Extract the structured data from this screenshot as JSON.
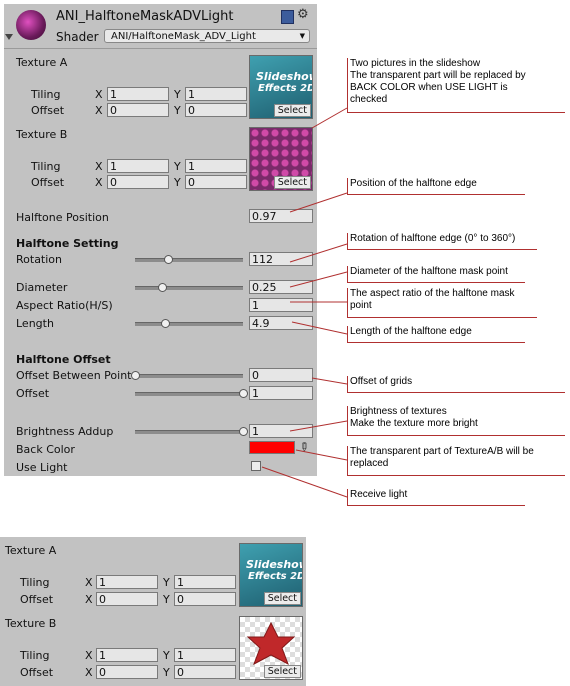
{
  "header": {
    "title": "ANI_HalftoneMaskADVLight",
    "shader_label": "Shader",
    "shader_value": "ANI/HalftoneMask_ADV_Light"
  },
  "textures": [
    {
      "label": "Texture A",
      "tiling_label": "Tiling",
      "offset_label": "Offset",
      "tiling_x": "1",
      "tiling_y": "1",
      "offset_x": "0",
      "offset_y": "0",
      "thumb_line1": "Slideshow",
      "thumb_line2": "Effects 2D",
      "select_label": "Select"
    },
    {
      "label": "Texture B",
      "tiling_label": "Tiling",
      "offset_label": "Offset",
      "tiling_x": "1",
      "tiling_y": "1",
      "offset_x": "0",
      "offset_y": "0",
      "select_label": "Select"
    }
  ],
  "axis": {
    "x": "X",
    "y": "Y"
  },
  "halftone_position": {
    "label": "Halftone Position",
    "value": "0.97"
  },
  "halftone_setting": {
    "heading": "Halftone Setting",
    "rotation": {
      "label": "Rotation",
      "value": "112",
      "level": 0.31
    },
    "diameter": {
      "label": "Diameter",
      "value": "0.25",
      "level": 0.25
    },
    "aspect": {
      "label": "Aspect Ratio(H/S)",
      "value": "1"
    },
    "length": {
      "label": "Length",
      "value": "4.9",
      "level": 0.28
    }
  },
  "halftone_offset": {
    "heading": "Halftone Offset",
    "between": {
      "label": "Offset Between Point",
      "value": "0",
      "level": 0.0
    },
    "offset": {
      "label": "Offset",
      "value": "1",
      "level": 1.0
    }
  },
  "brightness": {
    "label": "Brightness Addup",
    "value": "1",
    "level": 1.0
  },
  "back_color": {
    "label": "Back Color",
    "color": "#ff0000"
  },
  "use_light": {
    "label": "Use Light",
    "checked": false
  },
  "notes": {
    "slideshow": [
      "Two pictures in the slideshow",
      "The transparent part will be replaced by",
      "BACK COLOR when USE LIGHT is",
      "checked"
    ],
    "position": "Position of the halftone edge",
    "rotation": "Rotation of halftone edge (0° to 360°)",
    "diameter": "Diameter of the halftone mask point",
    "aspect": [
      "The aspect ratio of the halftone mask",
      "point"
    ],
    "length": "Length of the halftone edge",
    "offset": "Offset of grids",
    "brightness": [
      "Brightness of textures",
      "Make the texture more bright"
    ],
    "back_color": [
      "The transparent part of TextureA/B will be",
      "replaced"
    ],
    "light": "Receive light"
  },
  "lower_textures": [
    {
      "label": "Texture A",
      "tiling_label": "Tiling",
      "offset_label": "Offset",
      "tiling_x": "1",
      "tiling_y": "1",
      "offset_x": "0",
      "offset_y": "0",
      "thumb_line1": "Slideshow",
      "thumb_line2": "Effects 2D",
      "select_label": "Select"
    },
    {
      "label": "Texture B",
      "tiling_label": "Tiling",
      "offset_label": "Offset",
      "tiling_x": "1",
      "tiling_y": "1",
      "offset_x": "0",
      "offset_y": "0",
      "select_label": "Select"
    }
  ],
  "colors": {
    "panel": "#c2c2c2",
    "annotation_line": "#b03030",
    "back_color": "#ff0000",
    "thumb_teal": "#2a7f8f"
  }
}
